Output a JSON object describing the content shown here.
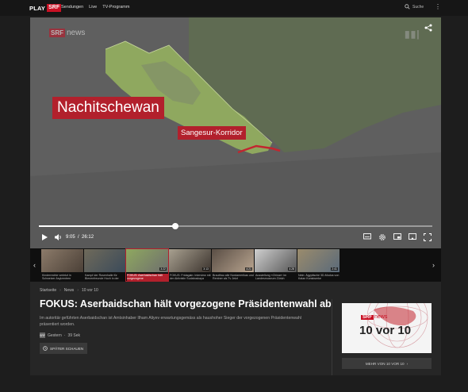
{
  "nav": {
    "logo_play": "PLAY",
    "logo_srf": "SRF",
    "links": [
      "Sendungen",
      "Live",
      "TV-Programm"
    ],
    "search_label": "Suche"
  },
  "player": {
    "watermark_brand": "SRF",
    "watermark_channel": "news",
    "map_label_region": "Nachitschewan",
    "map_label_corridor": "Sangesur-Korridor",
    "time_current": "9:05",
    "time_total": "26:12",
    "progress": 0.347
  },
  "strip": {
    "items": [
      {
        "caption": "Kinderrechte verletzt in Schweizer Asylzentren",
        "duration": ""
      },
      {
        "caption": "Kampf der Rosenhalle für Bienenfreunde Hoch in der",
        "duration": ""
      },
      {
        "caption": "FOKUS: Aserbaidschan hält vorgezogene",
        "duration": "3:22"
      },
      {
        "caption": "FOKUS: Fridagain: Interview mit der Aktivistin Sudaboskaya",
        "duration": "3:13"
      },
      {
        "caption": "Brautfrau alle Nordamerikas und Rentner als Tv Jetzt",
        "duration": "4:21"
      },
      {
        "caption": "Ausstellung «Chinar» im Landesmuseum Zürich",
        "duration": "4:28"
      },
      {
        "caption": "Nein: Ägyptische 3D-Modus von Kalan Kunstwerke",
        "duration": "2:41"
      }
    ]
  },
  "info": {
    "breadcrumb": [
      "Startseite",
      "News",
      "10 vor 10"
    ],
    "title": "FOKUS: Aserbaidschan hält vorgezogene Präsidentenwahl ab",
    "description": "Im autoritär geführten Aserbaidschan ist Amtsinhaber Ilham Aliyev erwartungsgemäss als haushoher Sieger der vorgezogenen Präsidentenwahl präsentiert worden.",
    "meta_channel_icon": "SRF",
    "meta_date": "Gestern",
    "meta_duration": "39 Sek",
    "later_label": "SPÄTER SCHAUEN",
    "show_brand": "SRF",
    "show_channel": "news",
    "show_name": "10 vor 10",
    "show_button": "MEHR VON 10 VOR 10"
  },
  "colors": {
    "accent": "#b2202c",
    "map_green": "#8fa85f",
    "map_gray": "#6e6e6e"
  }
}
